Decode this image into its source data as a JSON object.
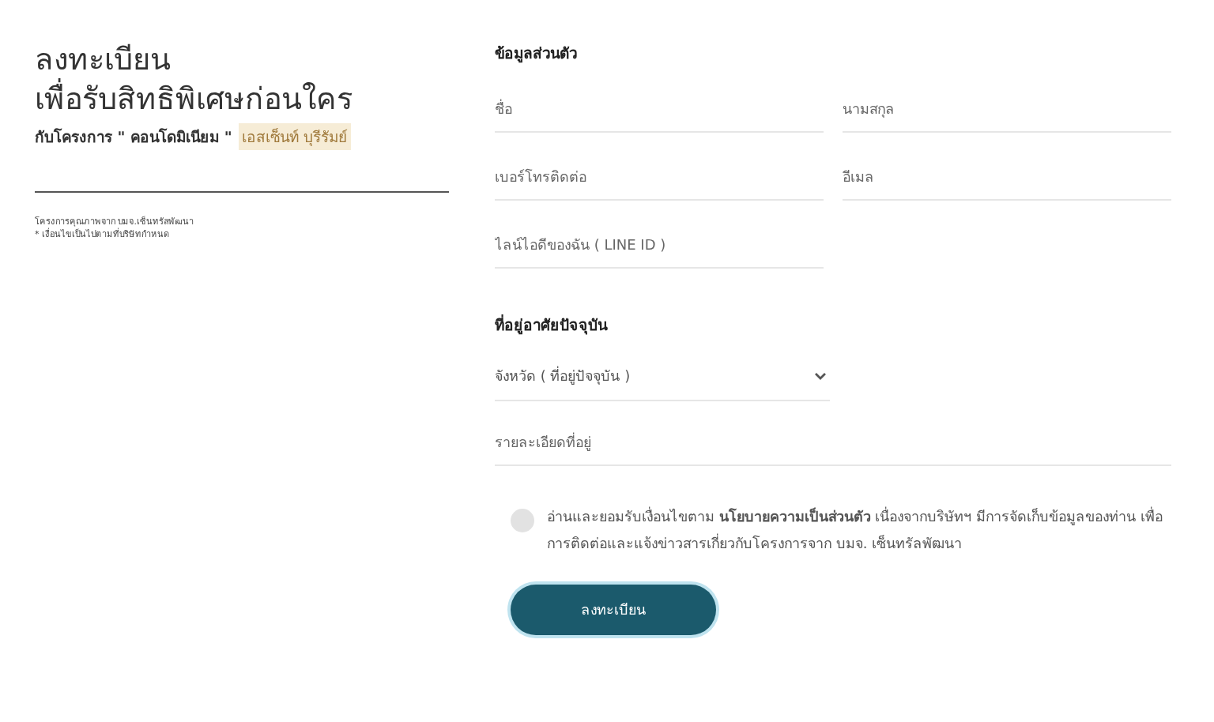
{
  "intro": {
    "title_lines": [
      "ลงทะเบียน",
      "เพื่อรับสิทธิพิเศษก่อนใคร"
    ],
    "subtitle": "กับโครงการ \" คอนโดมิเนียม \"",
    "project_name": "เอสเซ็นท์ บุรีรัมย์",
    "notes": [
      "โครงการคุณภาพจาก บมจ.เซ็นทรัลพัฒนา",
      "* เงื่อนไขเป็นไปตามที่บริษัทกำหนด"
    ]
  },
  "personal": {
    "heading": "ข้อมูลส่วนตัว",
    "fields": [
      {
        "placeholder": "ชื่อ"
      },
      {
        "placeholder": "นามสกุล"
      },
      {
        "placeholder": "เบอร์โทรติดต่อ"
      },
      {
        "placeholder": "อีเมล"
      },
      {
        "placeholder": "ไลน์ไอดีของฉัน ( LINE ID )"
      }
    ]
  },
  "address": {
    "heading": "ที่อยู่อาศัยปัจจุบัน",
    "province_select": {
      "placeholder": "จังหวัด ( ที่อยู่ปัจจุบัน )"
    },
    "detail_field": {
      "placeholder": "รายละเอียดที่อยู่"
    }
  },
  "consent": {
    "checked": false,
    "text": "อ่านและยอมรับเงื่อนไขตาม **นโยบายความเป็นส่วนตัว** เนื่องจากบริษัทฯ มีการจัดเก็บข้อมูลของท่าน เพื่อการติดต่อและแจ้งข่าวสารเกี่ยวกับโครงการจาก บมจ. เซ็นทรัลพัฒนา"
  },
  "submit": {
    "label": "ลงทะเบียน"
  }
}
